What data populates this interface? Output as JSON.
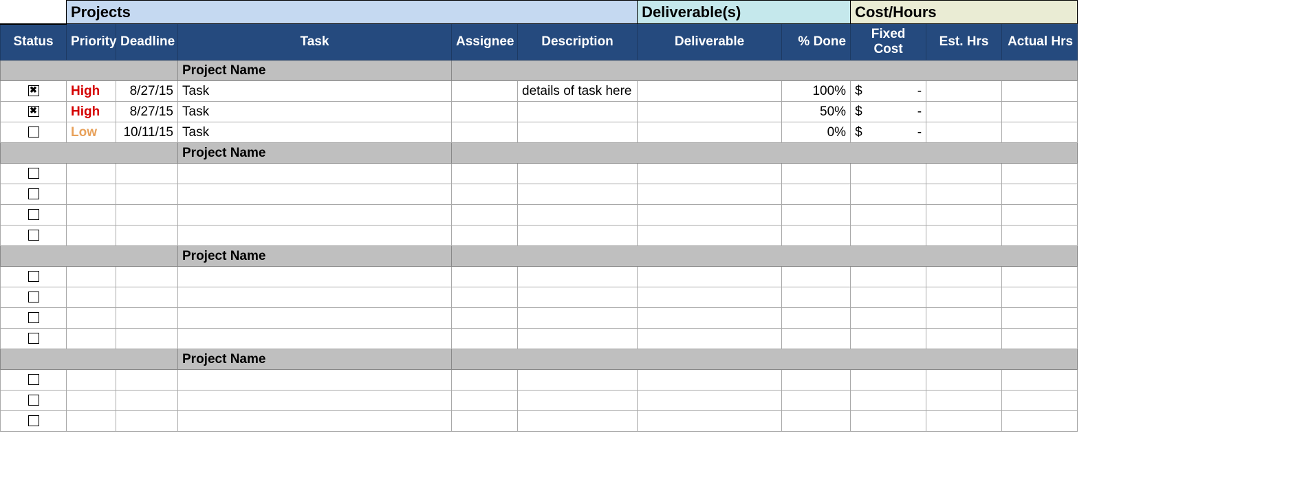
{
  "section_headers": {
    "projects": "Projects",
    "deliverable": "Deliverable(s)",
    "cost": "Cost/Hours"
  },
  "columns": {
    "status": "Status",
    "priority": "Priority",
    "deadline": "Deadline",
    "task": "Task",
    "assignee": "Assignee",
    "description": "Description",
    "deliverable": "Deliverable",
    "pct_done": "% Done",
    "fixed_cost": "Fixed Cost",
    "est_hrs": "Est. Hrs",
    "actual_hrs": "Actual Hrs"
  },
  "groups": [
    {
      "title": "Project Name",
      "rows": [
        {
          "checked": true,
          "priority": "High",
          "priority_class": "priority-high",
          "deadline": "8/27/15",
          "task": "Task",
          "assignee": "",
          "description": "details of task here",
          "deliverable": "",
          "pct_done": "100%",
          "fixed_cost_sym": "$",
          "fixed_cost_val": "-",
          "est_hrs": "",
          "actual_hrs": ""
        },
        {
          "checked": true,
          "priority": "High",
          "priority_class": "priority-high",
          "deadline": "8/27/15",
          "task": "Task",
          "assignee": "",
          "description": "",
          "deliverable": "",
          "pct_done": "50%",
          "fixed_cost_sym": "$",
          "fixed_cost_val": "-",
          "est_hrs": "",
          "actual_hrs": ""
        },
        {
          "checked": false,
          "priority": "Low",
          "priority_class": "priority-low",
          "deadline": "10/11/15",
          "task": "Task",
          "assignee": "",
          "description": "",
          "deliverable": "",
          "pct_done": "0%",
          "fixed_cost_sym": "$",
          "fixed_cost_val": "-",
          "est_hrs": "",
          "actual_hrs": ""
        }
      ]
    },
    {
      "title": "Project Name",
      "rows": [
        {
          "checked": false,
          "priority": "",
          "priority_class": "",
          "deadline": "",
          "task": "",
          "assignee": "",
          "description": "",
          "deliverable": "",
          "pct_done": "",
          "fixed_cost_sym": "",
          "fixed_cost_val": "",
          "est_hrs": "",
          "actual_hrs": ""
        },
        {
          "checked": false,
          "priority": "",
          "priority_class": "",
          "deadline": "",
          "task": "",
          "assignee": "",
          "description": "",
          "deliverable": "",
          "pct_done": "",
          "fixed_cost_sym": "",
          "fixed_cost_val": "",
          "est_hrs": "",
          "actual_hrs": ""
        },
        {
          "checked": false,
          "priority": "",
          "priority_class": "",
          "deadline": "",
          "task": "",
          "assignee": "",
          "description": "",
          "deliverable": "",
          "pct_done": "",
          "fixed_cost_sym": "",
          "fixed_cost_val": "",
          "est_hrs": "",
          "actual_hrs": ""
        },
        {
          "checked": false,
          "priority": "",
          "priority_class": "",
          "deadline": "",
          "task": "",
          "assignee": "",
          "description": "",
          "deliverable": "",
          "pct_done": "",
          "fixed_cost_sym": "",
          "fixed_cost_val": "",
          "est_hrs": "",
          "actual_hrs": ""
        }
      ]
    },
    {
      "title": "Project Name",
      "rows": [
        {
          "checked": false,
          "priority": "",
          "priority_class": "",
          "deadline": "",
          "task": "",
          "assignee": "",
          "description": "",
          "deliverable": "",
          "pct_done": "",
          "fixed_cost_sym": "",
          "fixed_cost_val": "",
          "est_hrs": "",
          "actual_hrs": ""
        },
        {
          "checked": false,
          "priority": "",
          "priority_class": "",
          "deadline": "",
          "task": "",
          "assignee": "",
          "description": "",
          "deliverable": "",
          "pct_done": "",
          "fixed_cost_sym": "",
          "fixed_cost_val": "",
          "est_hrs": "",
          "actual_hrs": ""
        },
        {
          "checked": false,
          "priority": "",
          "priority_class": "",
          "deadline": "",
          "task": "",
          "assignee": "",
          "description": "",
          "deliverable": "",
          "pct_done": "",
          "fixed_cost_sym": "",
          "fixed_cost_val": "",
          "est_hrs": "",
          "actual_hrs": ""
        },
        {
          "checked": false,
          "priority": "",
          "priority_class": "",
          "deadline": "",
          "task": "",
          "assignee": "",
          "description": "",
          "deliverable": "",
          "pct_done": "",
          "fixed_cost_sym": "",
          "fixed_cost_val": "",
          "est_hrs": "",
          "actual_hrs": ""
        }
      ]
    },
    {
      "title": "Project Name",
      "rows": [
        {
          "checked": false,
          "priority": "",
          "priority_class": "",
          "deadline": "",
          "task": "",
          "assignee": "",
          "description": "",
          "deliverable": "",
          "pct_done": "",
          "fixed_cost_sym": "",
          "fixed_cost_val": "",
          "est_hrs": "",
          "actual_hrs": ""
        },
        {
          "checked": false,
          "priority": "",
          "priority_class": "",
          "deadline": "",
          "task": "",
          "assignee": "",
          "description": "",
          "deliverable": "",
          "pct_done": "",
          "fixed_cost_sym": "",
          "fixed_cost_val": "",
          "est_hrs": "",
          "actual_hrs": ""
        },
        {
          "checked": false,
          "priority": "",
          "priority_class": "",
          "deadline": "",
          "task": "",
          "assignee": "",
          "description": "",
          "deliverable": "",
          "pct_done": "",
          "fixed_cost_sym": "",
          "fixed_cost_val": "",
          "est_hrs": "",
          "actual_hrs": ""
        }
      ]
    }
  ]
}
